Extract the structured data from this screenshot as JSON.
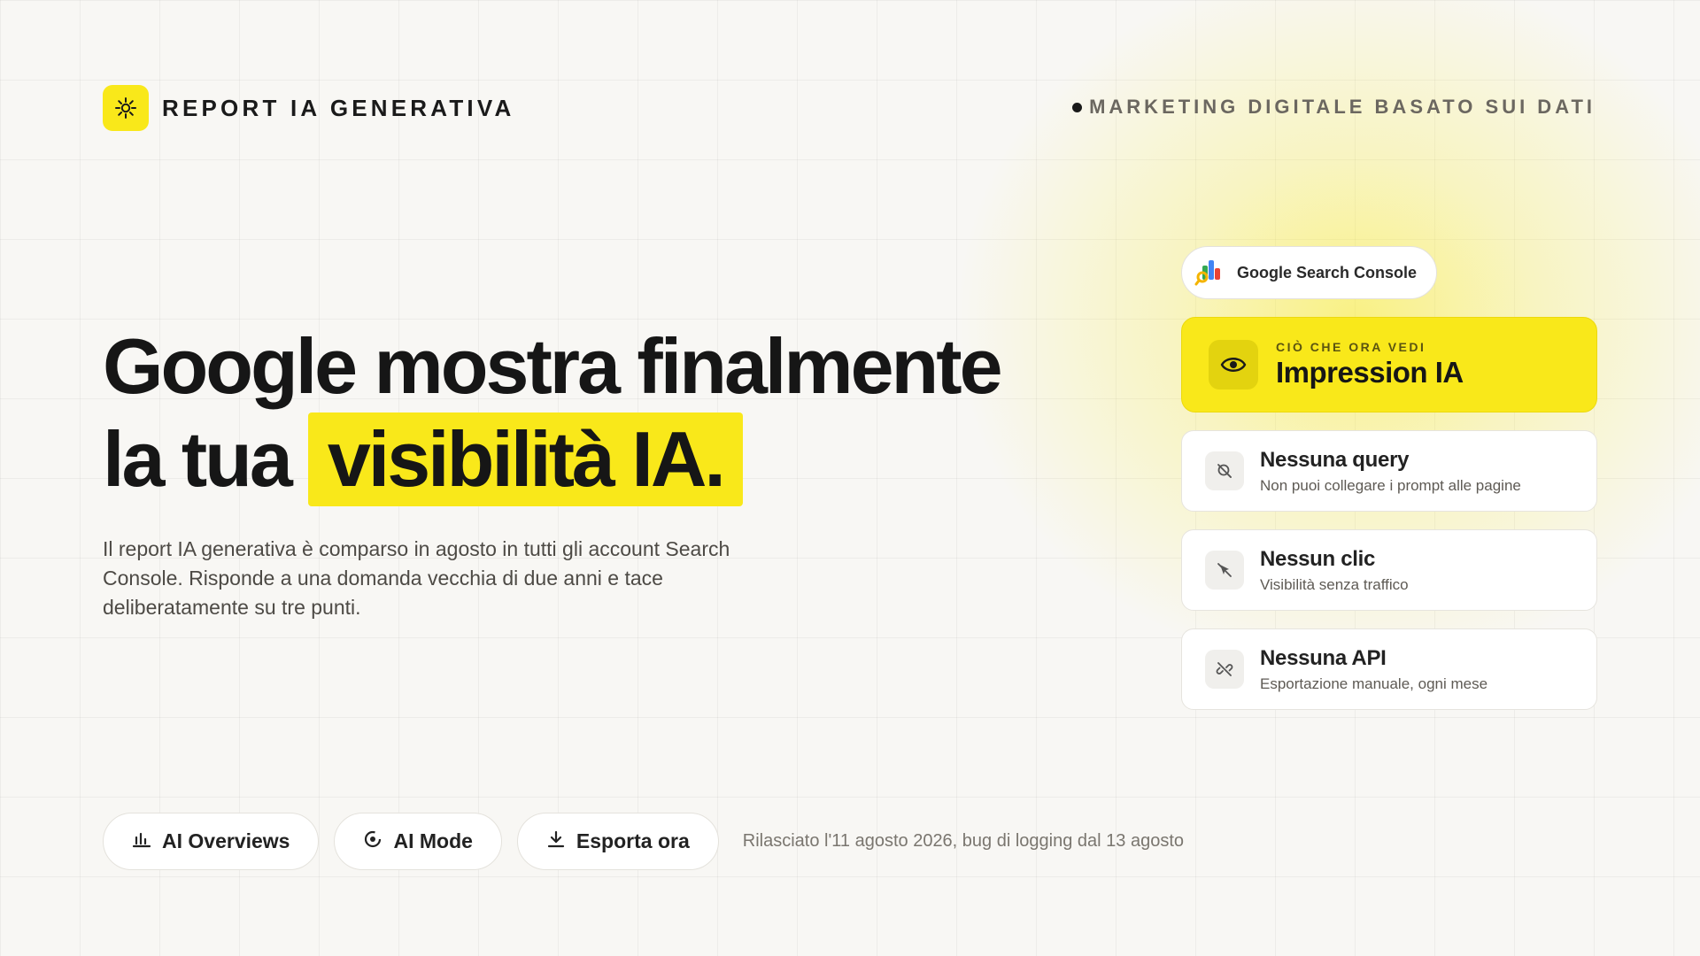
{
  "header": {
    "brand_name": "REPORT IA GENERATIVA",
    "brand_icon": "sun-icon",
    "tagline": "MARKETING DIGITALE BASATO SUI DATI"
  },
  "hero": {
    "headline_line1": "Google mostra finalmente",
    "headline_line2_prefix": "la tua",
    "headline_highlight": "visibilità IA.",
    "description": "Il report IA generativa è comparso in agosto in tutti gli account Search Console. Risponde a una domanda vecchia di due anni e tace deliberatamente su tre punti."
  },
  "actions": {
    "buttons": [
      {
        "label": "AI Overviews",
        "icon": "bar-chart-icon"
      },
      {
        "label": "AI Mode",
        "icon": "target-icon"
      },
      {
        "label": "Esporta ora",
        "icon": "download-icon"
      }
    ],
    "release_note": "Rilasciato l'11 agosto 2026, bug di logging dal 13 agosto"
  },
  "panel": {
    "source_chip": {
      "label": "Google Search Console",
      "icon": "search-console-icon"
    },
    "feature": {
      "kicker": "CIÒ CHE ORA VEDI",
      "title": "Impression IA",
      "icon": "eye-icon"
    },
    "items": [
      {
        "title": "Nessuna query",
        "subtitle": "Non puoi collegare i prompt alle pagine",
        "icon": "search-off-icon"
      },
      {
        "title": "Nessun clic",
        "subtitle": "Visibilità senza traffico",
        "icon": "cursor-off-icon"
      },
      {
        "title": "Nessuna API",
        "subtitle": "Esportazione manuale, ogni mese",
        "icon": "link-off-icon"
      }
    ]
  },
  "colors": {
    "accent": "#f9e81a",
    "background": "#f8f7f4",
    "text": "#161616"
  }
}
